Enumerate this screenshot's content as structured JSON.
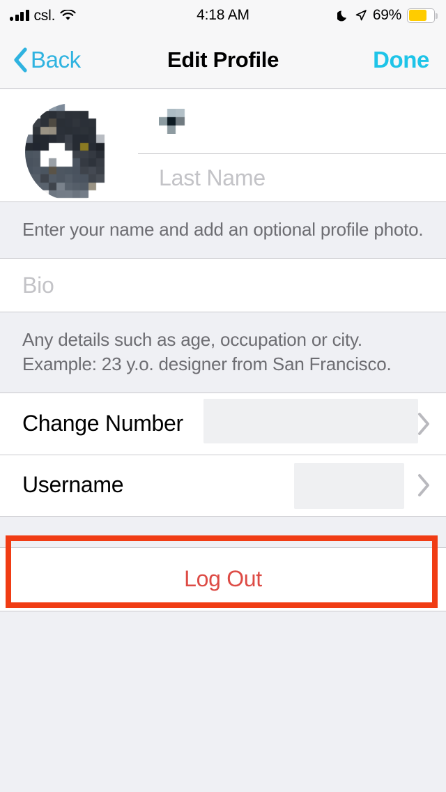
{
  "status_bar": {
    "carrier": "csl.",
    "time": "4:18 AM",
    "battery_percent": "69%",
    "signal_icon": "signal-bars-icon",
    "wifi_icon": "wifi-icon",
    "dnd_icon": "moon-icon",
    "location_icon": "location-arrow-icon",
    "battery_icon": "battery-icon",
    "battery_color": "#ffcc00"
  },
  "nav_bar": {
    "back_label": "Back",
    "title": "Edit Profile",
    "done_label": "Done",
    "accent_color": "#1ec4e8"
  },
  "name_section": {
    "avatar_alt": "profile-photo (pixelated)",
    "first_name_value": "",
    "first_name_redacted": true,
    "last_name_placeholder": "Last Name",
    "last_name_value": "",
    "footer": "Enter your name and add an optional profile photo."
  },
  "bio_section": {
    "placeholder": "Bio",
    "value": "",
    "footer": "Any details such as age, occupation or city. Example: 23 y.o. designer from San Francisco."
  },
  "settings_rows": [
    {
      "label": "Change Number",
      "value": "",
      "value_redacted": true,
      "chevron": "chevron-right-icon"
    },
    {
      "label": "Username",
      "value": "",
      "value_redacted": true,
      "chevron": "chevron-right-icon"
    }
  ],
  "logout": {
    "label": "Log Out",
    "color": "#dd4b45"
  },
  "annotation": {
    "target": "Username",
    "color": "#f03c14"
  }
}
